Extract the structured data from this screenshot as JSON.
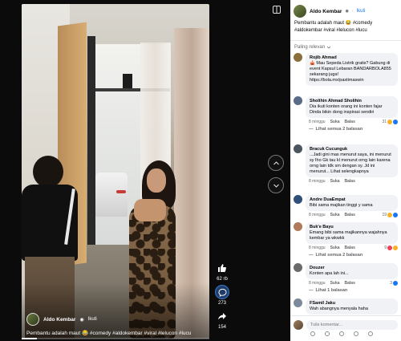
{
  "video": {
    "author": "Aldo Kembar",
    "verified_mark": "◉",
    "follow_label": "Ikuti",
    "caption": "Pembantu adalah maut 😂 #comedy #aldokembar #viral #lelucon #lucu",
    "progress": 0.08
  },
  "reactions": {
    "like_count": "62 rb",
    "comment_count": "273",
    "share_count": "154"
  },
  "panel": {
    "author": "Aldo Kembar",
    "verified_mark": "◉",
    "dot": "·",
    "follow_label": "Ikuti",
    "caption": "Pembantu adalah maut 😂 #comedy #aldokembar #viral #lelucon #lucu",
    "sort_label": "Paling relevan",
    "comments": [
      {
        "name": "Rojib Ahmad",
        "text": "🎪 Mau Sepeda Listrik gratis? Gabung di event Kapsul Lebaran BANDARBOLA855 sekarang juga! https://bola.mx/pastimaswin",
        "time": "",
        "like": "",
        "reply": "",
        "reactions": "",
        "avatar_color": "#8a6f3a"
      },
      {
        "name": "Sholihin Ahmad Sholihin",
        "text": "Dia ikuti konten orang ini konten fajar Dinda bikin dong inspirasi sendiri",
        "time": "8 minggu",
        "like": "Suka",
        "reply": "Balas",
        "reactions": "31",
        "avatar_color": "#5a6b8a"
      },
      {
        "name": "Bracuk Cucunguk",
        "text": "...Jadi gini mas menurut saya, ini menurut sy Iho Gk tau kl menurut orng lain karena orng lain tdk sm dengan sy. Jd ini menurut... Lihat selengkapnya",
        "time": "8 minggu",
        "like": "Suka",
        "reply": "Balas",
        "reactions": "",
        "avatar_color": "#4a5560"
      },
      {
        "name": "Andre DuaEmpat",
        "text": "Bibi sama majikan tinggi y sama",
        "time": "8 minggu",
        "like": "Suka",
        "reply": "Balas",
        "reactions": "19",
        "avatar_color": "#2d4f7a"
      },
      {
        "name": "Buk'e Bayu",
        "text": "Emang bibi sama majikannya wajahnya kembar ya wkwkk",
        "time": "8 minggu",
        "like": "Suka",
        "reply": "Balas",
        "reactions": "9",
        "avatar_color": "#b07a5a"
      },
      {
        "name": "Douzer",
        "text": "Konten apa lah ini...",
        "time": "8 minggu",
        "like": "Suka",
        "reply": "Balas",
        "reactions": "3",
        "avatar_color": "#6a6a6a"
      },
      {
        "name": "FSamil Jaku",
        "text": "Wah abangnya menyala haha",
        "time": "",
        "like": "",
        "reply": "",
        "reactions": "",
        "avatar_color": "#7a8a9a"
      }
    ],
    "replies": [
      "Lihat semua 2 balasan",
      "Lihat semua 2 balasan",
      "Lihat 1 balasan"
    ],
    "input_placeholder": "Tulis komentar..."
  }
}
